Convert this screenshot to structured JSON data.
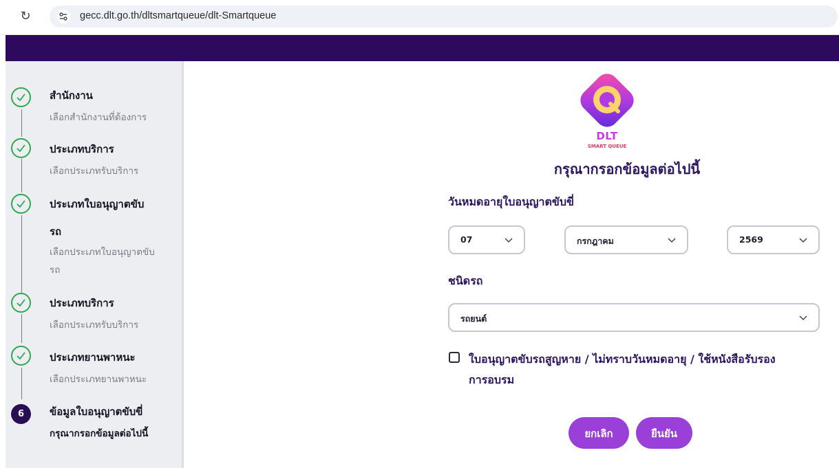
{
  "browser": {
    "url": "gecc.dlt.go.th/dltsmartqueue/dlt-Smartqueue"
  },
  "sidebar": {
    "steps": [
      {
        "title": "สำนักงาน",
        "subtitle": "เลือกสำนักงานที่ต้องการ",
        "state": "done"
      },
      {
        "title": "ประเภทบริการ",
        "subtitle": "เลือกประเภทรับบริการ",
        "state": "done"
      },
      {
        "title": "ประเภทใบอนุญาตขับ",
        "title2": "รถ",
        "subtitle": "เลือกประเภทใบอนุญาตขับ",
        "subtitle2": "รถ",
        "state": "done"
      },
      {
        "title": "ประเภทบริการ",
        "subtitle": "เลือกประเภทรับบริการ",
        "state": "done"
      },
      {
        "title": "ประเภทยานพาหนะ",
        "subtitle": "เลือกประเภทยานพาหนะ",
        "state": "done"
      },
      {
        "number": "6",
        "title": "ข้อมูลใบอนุญาตขับขี่",
        "subtitle": "กรุณากรอกข้อมูลต่อไปนี้",
        "state": "current"
      }
    ]
  },
  "logo": {
    "letter": "Q",
    "brand": "DLT",
    "tagline": "SMART QUEUE"
  },
  "main": {
    "heading": "กรุณากรอกข้อมูลต่อไปนี้",
    "expiry_label": "วันหมดอายุใบอนุญาตขับขี่",
    "day_value": "07",
    "month_value": "กรกฎาคม",
    "year_value": "2569",
    "vehicle_label": "ชนิดรถ",
    "vehicle_value": "รถยนต์",
    "checkbox_line1": "ใบอนุญาตขับรถสูญหาย / ไม่ทราบวันหมดอายุ / ใช้หนังสือรับรอง",
    "checkbox_line2": "การอบรม",
    "cancel_label": "ยกเลิก",
    "confirm_label": "ยืนยัน"
  },
  "colors": {
    "header": "#2e0a5e",
    "button": "#9b3fd9",
    "check": "#2fa84f",
    "heading": "#2c1560"
  }
}
